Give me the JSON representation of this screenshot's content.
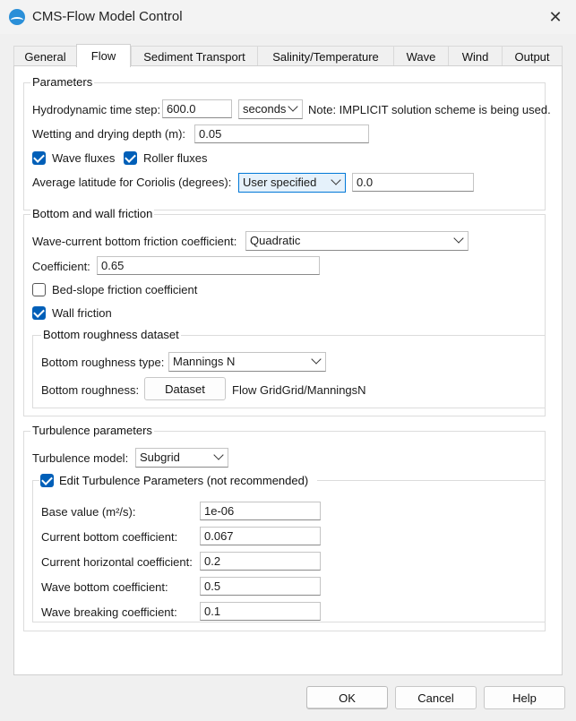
{
  "window": {
    "title": "CMS-Flow Model Control"
  },
  "tabs": [
    "General",
    "Flow",
    "Sediment Transport",
    "Salinity/Temperature",
    "Wave",
    "Wind",
    "Output"
  ],
  "parameters": {
    "legend": "Parameters",
    "time_step_label": "Hydrodynamic time step:",
    "time_step_value": "600.0",
    "time_unit": "seconds",
    "note": "Note: IMPLICIT solution scheme is being used.",
    "wetting_label": "Wetting and drying depth (m):",
    "wetting_value": "0.05",
    "wave_fluxes_label": "Wave fluxes",
    "wave_fluxes_checked": true,
    "roller_fluxes_label": "Roller fluxes",
    "roller_fluxes_checked": true,
    "latitude_label": "Average latitude for Coriolis (degrees):",
    "latitude_mode": "User specified",
    "latitude_value": "0.0"
  },
  "friction": {
    "legend": "Bottom and wall friction",
    "wave_current_label": "Wave-current bottom friction coefficient:",
    "wave_current_value": "Quadratic",
    "coefficient_label": "Coefficient:",
    "coefficient_value": "0.65",
    "bed_slope_label": "Bed-slope friction coefficient",
    "bed_slope_checked": false,
    "wall_friction_label": "Wall friction",
    "wall_friction_checked": true,
    "roughness": {
      "legend": "Bottom roughness dataset",
      "type_label": "Bottom roughness type:",
      "type_value": "Mannings N",
      "roughness_label": "Bottom roughness:",
      "dataset_button": "Dataset",
      "dataset_path": "Flow GridGrid/ManningsN"
    }
  },
  "turbulence": {
    "legend": "Turbulence parameters",
    "model_label": "Turbulence model:",
    "model_value": "Subgrid",
    "edit_label": "Edit Turbulence Parameters (not recommended)",
    "edit_checked": true,
    "base_label": "Base value (m²/s):",
    "base_value": "1e-06",
    "cur_bottom_label": "Current bottom coefficient:",
    "cur_bottom_value": "0.067",
    "cur_horiz_label": "Current horizontal coefficient:",
    "cur_horiz_value": "0.2",
    "wave_bottom_label": "Wave bottom coefficient:",
    "wave_bottom_value": "0.5",
    "wave_breaking_label": "Wave breaking coefficient:",
    "wave_breaking_value": "0.1"
  },
  "buttons": {
    "ok": "OK",
    "cancel": "Cancel",
    "help": "Help"
  },
  "colors": {
    "accent": "#005fb8",
    "focus_border": "#0078d7",
    "focus_fill": "#e5f1fb"
  }
}
